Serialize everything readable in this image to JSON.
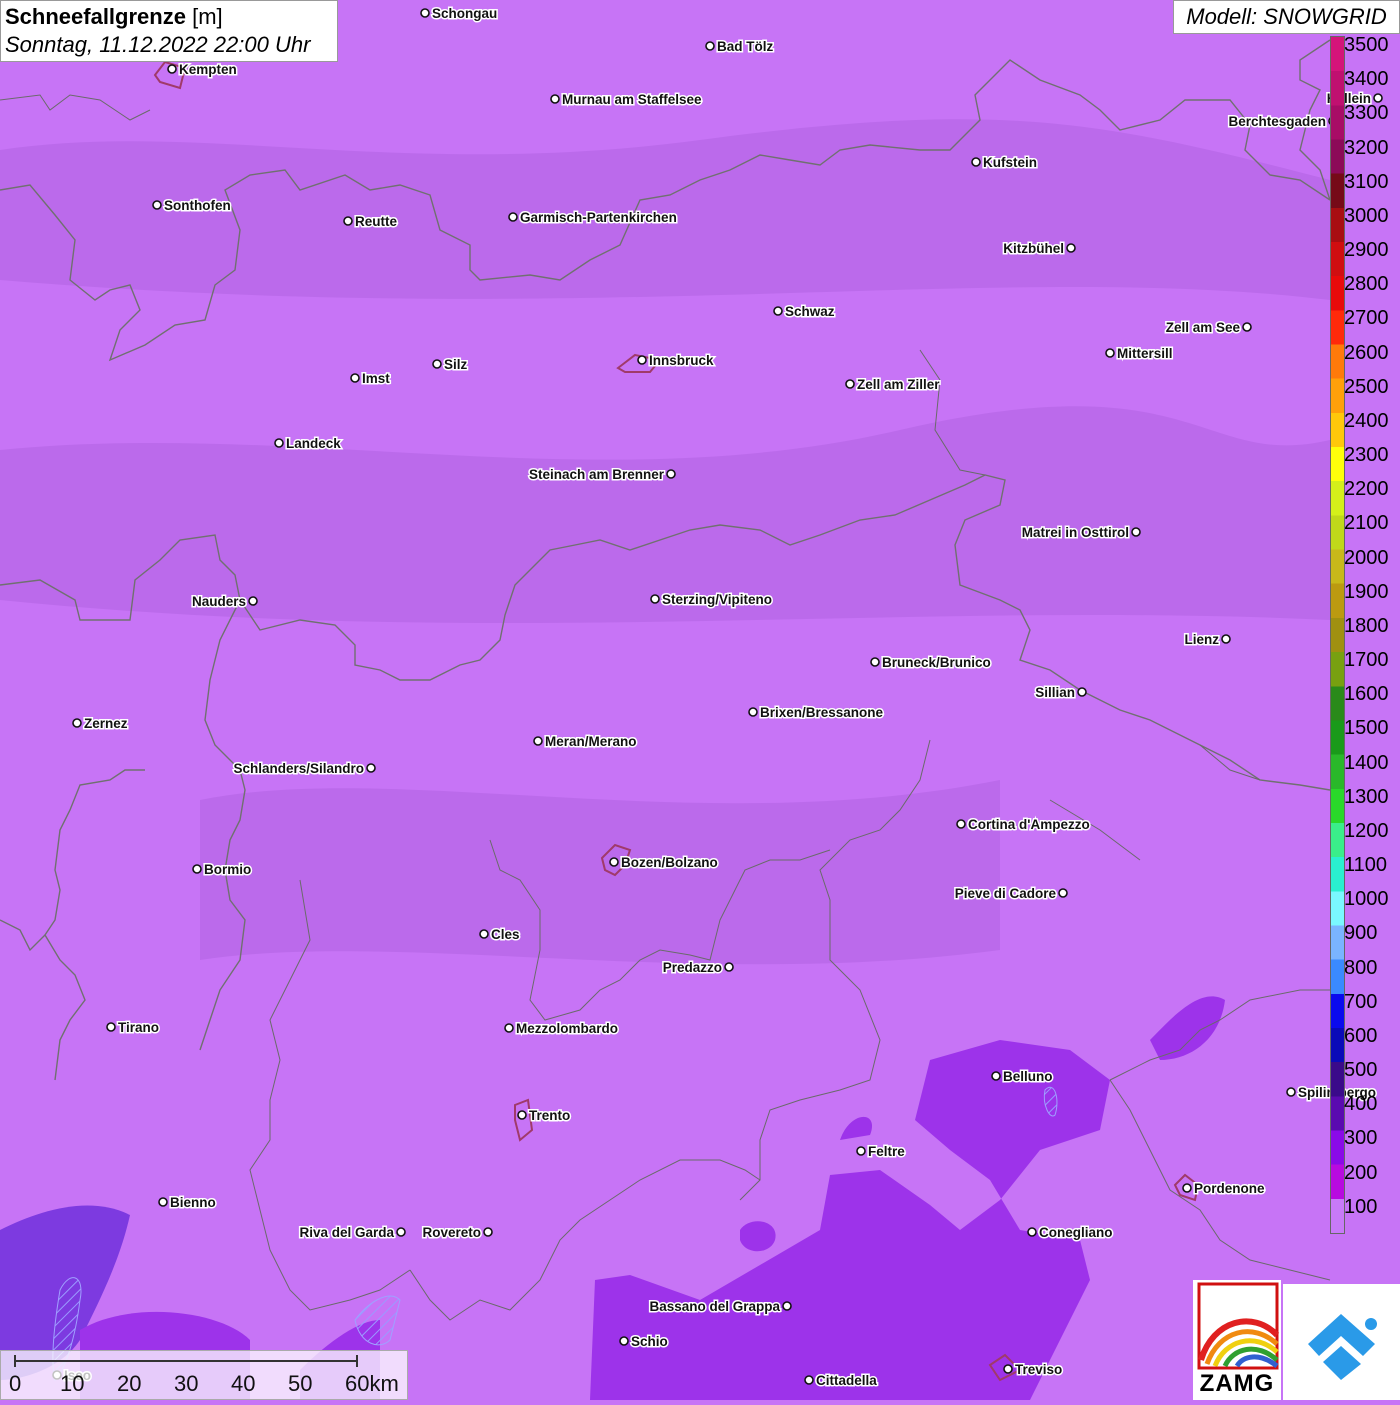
{
  "title": {
    "main": "Schneefallgrenze",
    "unit": "[m]",
    "datetime": "Sonntag, 11.12.2022 22:00 Uhr"
  },
  "model": "Modell: SNOWGRID",
  "legend": {
    "labels": [
      "3500",
      "3400",
      "3300",
      "3200",
      "3100",
      "3000",
      "2900",
      "2800",
      "2700",
      "2600",
      "2500",
      "2400",
      "2300",
      "2200",
      "2100",
      "2000",
      "1900",
      "1800",
      "1700",
      "1600",
      "1500",
      "1400",
      "1300",
      "1200",
      "1100",
      "1000",
      "900",
      "800",
      "700",
      "600",
      "500",
      "400",
      "300",
      "200",
      "100"
    ],
    "colors": [
      "#d4147a",
      "#c01070",
      "#a80c66",
      "#8c0a58",
      "#760a18",
      "#a80e12",
      "#d00e10",
      "#e80a0a",
      "#ff2a0a",
      "#ff7a0a",
      "#ffa00a",
      "#ffc80a",
      "#ffff0a",
      "#d4f01a",
      "#c0d81a",
      "#c8b81a",
      "#bc9a10",
      "#a09010",
      "#78a010",
      "#2a8a1a",
      "#1a9a1a",
      "#2ab82a",
      "#2ad82a",
      "#3aee8a",
      "#2af0d0",
      "#7af8ff",
      "#7ab4ff",
      "#3a8aff",
      "#0a0aee",
      "#0a0ab8",
      "#3a0a8a",
      "#5a0ab0",
      "#8a0ae8",
      "#b80ae0",
      "#c87af8"
    ]
  },
  "cities": [
    {
      "name": "Schongau"
    },
    {
      "name": "Bad Tölz"
    },
    {
      "name": "Kempten"
    },
    {
      "name": "Murnau am Staffelsee"
    },
    {
      "name": "Hallein"
    },
    {
      "name": "Berchtesgaden"
    },
    {
      "name": "Kufstein"
    },
    {
      "name": "Sonthofen"
    },
    {
      "name": "Reutte"
    },
    {
      "name": "Garmisch-Partenkirchen"
    },
    {
      "name": "Kitzbühel"
    },
    {
      "name": "Schwaz"
    },
    {
      "name": "Zell am See"
    },
    {
      "name": "Innsbruck"
    },
    {
      "name": "Mittersill"
    },
    {
      "name": "Imst"
    },
    {
      "name": "Silz"
    },
    {
      "name": "Zell am Ziller"
    },
    {
      "name": "Landeck"
    },
    {
      "name": "Steinach am Brenner"
    },
    {
      "name": "Matrei in Osttirol"
    },
    {
      "name": "Nauders"
    },
    {
      "name": "Sterzing/Vipiteno"
    },
    {
      "name": "Lienz"
    },
    {
      "name": "Bruneck/Brunico"
    },
    {
      "name": "Sillian"
    },
    {
      "name": "Brixen/Bressanone"
    },
    {
      "name": "Zernez"
    },
    {
      "name": "Meran/Merano"
    },
    {
      "name": "Schlanders/Silandro"
    },
    {
      "name": "Cortina d'Ampezzo"
    },
    {
      "name": "Bozen/Bolzano"
    },
    {
      "name": "Bormio"
    },
    {
      "name": "Pieve di Cadore"
    },
    {
      "name": "Cles"
    },
    {
      "name": "Predazzo"
    },
    {
      "name": "Tirano"
    },
    {
      "name": "Mezzolombardo"
    },
    {
      "name": "Belluno"
    },
    {
      "name": "Spilimbergo"
    },
    {
      "name": "Trento"
    },
    {
      "name": "Feltre"
    },
    {
      "name": "Pordenone"
    },
    {
      "name": "Bienno"
    },
    {
      "name": "Riva del Garda"
    },
    {
      "name": "Rovereto"
    },
    {
      "name": "Conegliano"
    },
    {
      "name": "Bassano del Grappa"
    },
    {
      "name": "Schio"
    },
    {
      "name": "Iseo"
    },
    {
      "name": "Treviso"
    },
    {
      "name": "Cittadella"
    }
  ],
  "scalebar": {
    "ticks": [
      "0",
      "10",
      "20",
      "30",
      "40",
      "50",
      "60km"
    ]
  },
  "logos": {
    "zamg": "ZAMG"
  }
}
